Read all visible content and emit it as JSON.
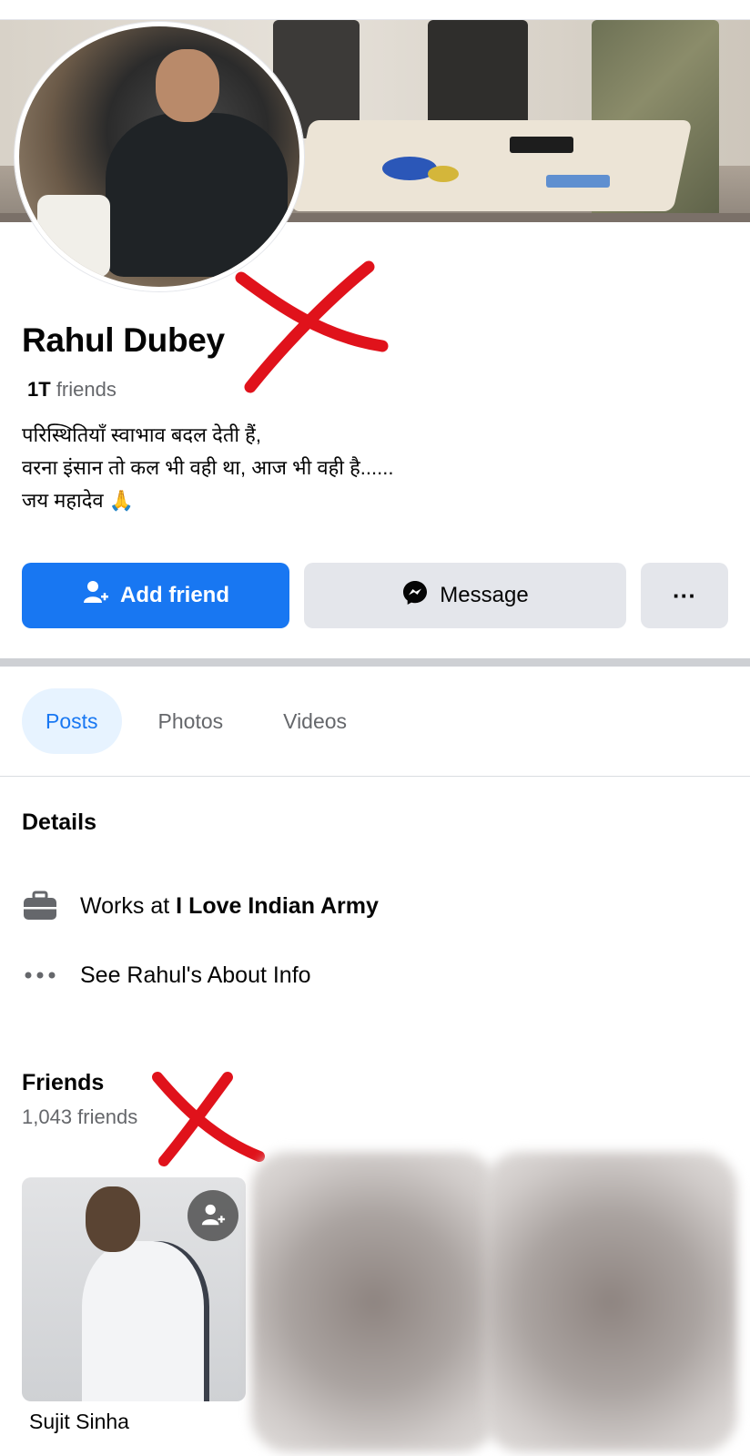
{
  "profile": {
    "name": "Rahul Dubey",
    "friends_count_value": "1T",
    "friends_count_label": "friends",
    "bio": "परिस्थितियाँ स्वाभाव बदल देती हैं,\n वरना इंसान तो कल भी वही था, आज भी वही है......\nजय महादेव 🙏"
  },
  "actions": {
    "add_friend_label": "Add friend",
    "message_label": "Message",
    "more_label": "···"
  },
  "tabs": [
    {
      "label": "Posts",
      "active": true
    },
    {
      "label": "Photos",
      "active": false
    },
    {
      "label": "Videos",
      "active": false
    }
  ],
  "details": {
    "title": "Details",
    "work_prefix": "Works at",
    "work_place": "I Love Indian Army",
    "about_link": "See Rahul's About Info"
  },
  "friends": {
    "title": "Friends",
    "subtitle": "1,043 friends",
    "cards": [
      {
        "name": "Sujit Sinha"
      }
    ]
  },
  "colors": {
    "accent": "#1877f2",
    "annotation_red": "#e0121b",
    "secondary_button": "#e4e6eb"
  },
  "icons": [
    "add-friend-icon",
    "messenger-icon",
    "more-icon",
    "briefcase-icon",
    "ellipsis-icon",
    "add-friend-badge-icon"
  ]
}
